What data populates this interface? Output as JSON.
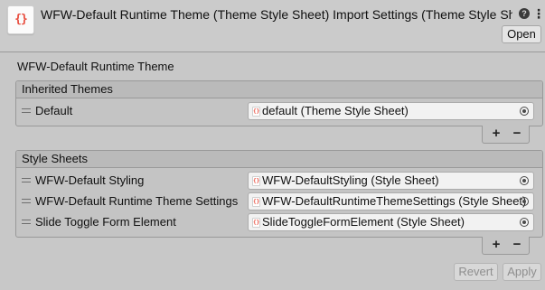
{
  "header": {
    "title": "WFW-Default Runtime Theme (Theme Style Sheet) Import Settings (Theme Style Sheet)",
    "file_icon": "{}",
    "help_icon": "?",
    "kebab_icon": "⋮",
    "open_label": "Open"
  },
  "section_title": "WFW-Default Runtime Theme",
  "inherited_themes": {
    "header": "Inherited Themes",
    "items": [
      {
        "label": "Default",
        "value": "default (Theme Style Sheet)"
      }
    ]
  },
  "style_sheets": {
    "header": "Style Sheets",
    "items": [
      {
        "label": "WFW-Default Styling",
        "value": "WFW-DefaultStyling (Style Sheet)"
      },
      {
        "label": "WFW-Default Runtime Theme Settings",
        "value": "WFW-DefaultRuntimeThemeSettings (Style Sheet)"
      },
      {
        "label": "Slide Toggle Form Element",
        "value": "SlideToggleFormElement (Style Sheet)"
      }
    ]
  },
  "list_controls": {
    "add": "+",
    "remove": "−"
  },
  "footer": {
    "revert_label": "Revert",
    "apply_label": "Apply"
  },
  "colors": {
    "asset_icon": "#e84b3c",
    "background": "#c8c8c8",
    "field": "#f2f2f2"
  }
}
